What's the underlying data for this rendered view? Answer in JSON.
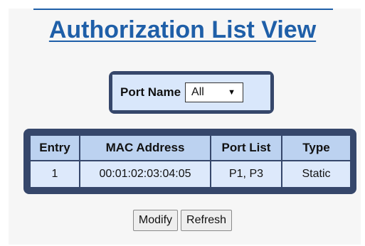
{
  "page": {
    "title": "Authorization List View"
  },
  "filter": {
    "label": "Port Name",
    "selected": "All"
  },
  "table": {
    "headers": [
      "Entry",
      "MAC Address",
      "Port List",
      "Type"
    ],
    "rows": [
      [
        "1",
        "00:01:02:03:04:05",
        "P1, P3",
        "Static"
      ]
    ]
  },
  "buttons": {
    "modify_label": "Modify",
    "refresh_label": "Refresh"
  },
  "colors": {
    "title": "#1f5fa8",
    "frame": "#36476b",
    "header_cell": "#bcd2f0",
    "data_cell": "#dde9fb"
  }
}
